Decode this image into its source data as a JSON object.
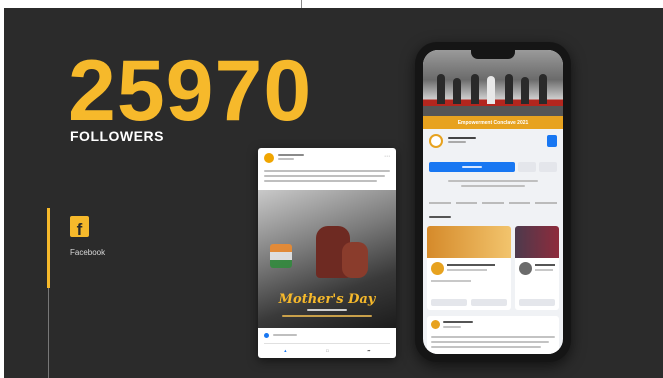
{
  "stats": {
    "count": "25970",
    "label": "FOLLOWERS"
  },
  "platform": {
    "icon": "facebook-icon",
    "icon_glyph": "f",
    "name": "Facebook"
  },
  "phone": {
    "cover_caption": "Empowerment Conclave 2021"
  },
  "post": {
    "image_title": "Mother's Day"
  },
  "colors": {
    "accent": "#f6b92b",
    "background": "#2b2b2b",
    "facebook_blue": "#1877f2",
    "cover_band": "#e7a21f"
  }
}
